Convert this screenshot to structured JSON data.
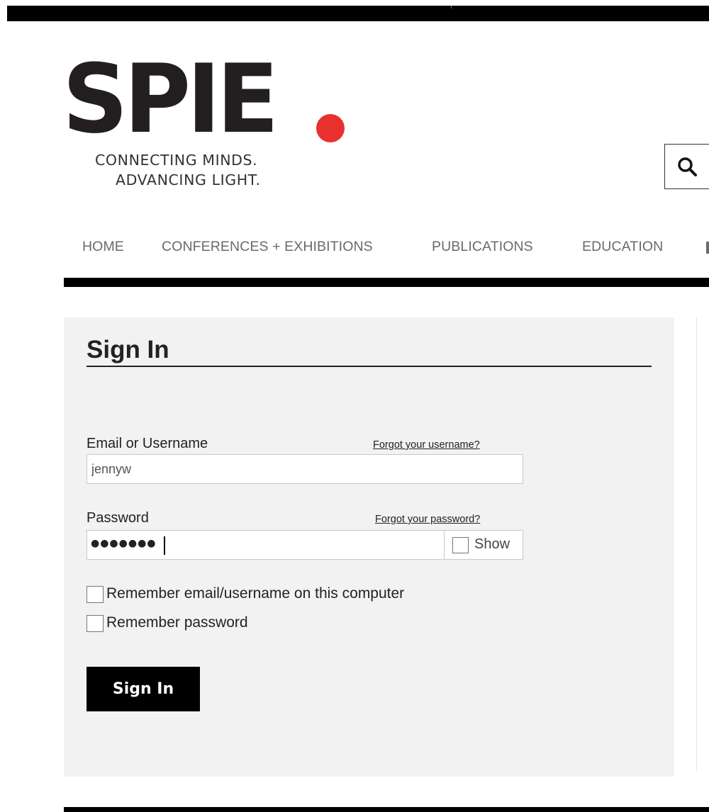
{
  "logo": {
    "wordmark": "SPIE",
    "tagline_line1": "CONNECTING MINDS.",
    "tagline_line2": "ADVANCING LIGHT.",
    "accent_color": "#e8312f"
  },
  "search": {
    "icon": "search-icon"
  },
  "nav": {
    "items": [
      "HOME",
      "CONFERENCES + EXHIBITIONS",
      "PUBLICATIONS",
      "EDUCATION"
    ]
  },
  "signin": {
    "title": "Sign In",
    "username_label": "Email or Username",
    "forgot_username": "Forgot your username?",
    "username_value": "jennyw",
    "password_label": "Password",
    "forgot_password": "Forgot your password?",
    "password_mask": "●●●●●●●",
    "show_label": "Show",
    "remember_username": "Remember email/username on this computer",
    "remember_password": "Remember password",
    "submit_label": "Sign In"
  }
}
